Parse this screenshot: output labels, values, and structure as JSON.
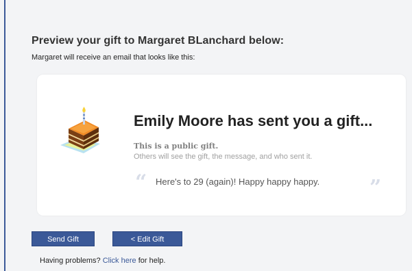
{
  "header": {
    "title": "Preview your gift to Margaret BLanchard below:",
    "subtitle": "Margaret will receive an email that looks like this:"
  },
  "preview": {
    "icon": "birthday-cake-icon",
    "title": "Emily Moore has sent you a gift...",
    "public_label": "This is a public gift.",
    "public_description": "Others will see the gift, the message, and who sent it.",
    "message": "Here's to 29 (again)! Happy happy happy."
  },
  "actions": {
    "send_label": "Send Gift",
    "edit_label": "< Edit Gift"
  },
  "help": {
    "prefix": "Having problems?",
    "link_label": "Click here",
    "suffix": "for help."
  },
  "colors": {
    "accent": "#3b5998",
    "card_background": "#ffffff",
    "page_background": "#f3f4f6"
  }
}
